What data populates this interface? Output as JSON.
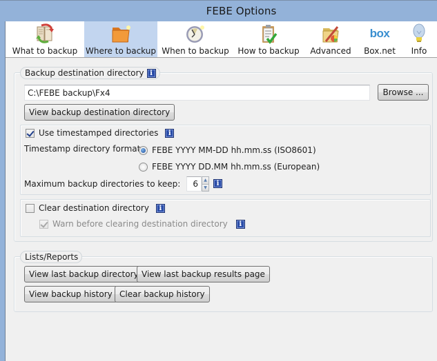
{
  "window": {
    "title": "FEBE Options"
  },
  "toolbar": {
    "items": [
      {
        "label": "What to backup",
        "icon": "backup-book-icon",
        "active": false
      },
      {
        "label": "Where to backup",
        "icon": "folder-icon",
        "active": true
      },
      {
        "label": "When to backup",
        "icon": "clock-icon",
        "active": false
      },
      {
        "label": "How to backup",
        "icon": "clipboard-check-icon",
        "active": false
      },
      {
        "label": "Advanced",
        "icon": "advanced-tools-icon",
        "active": false
      },
      {
        "label": "Box.net",
        "icon": "box-logo-icon",
        "active": false
      },
      {
        "label": "Info",
        "icon": "lightbulb-icon",
        "active": false
      }
    ],
    "box_logo_text": "box"
  },
  "destination": {
    "legend": "Backup destination directory",
    "path_value": "C:\\FEBE backup\\Fx4",
    "browse_label": "Browse ...",
    "view_dir_label": "View backup destination directory",
    "info_glyph": "i"
  },
  "timestamp": {
    "use_label": "Use timestamped directories",
    "use_checked": true,
    "format_label": "Timestamp directory format:",
    "formats": [
      {
        "label": "FEBE YYYY MM-DD hh.mm.ss (ISO8601)",
        "selected": true
      },
      {
        "label": "FEBE YYYY DD.MM hh.mm.ss (European)",
        "selected": false
      }
    ],
    "max_label": "Maximum backup directories to keep:",
    "max_value": "6",
    "spin_up": "▲",
    "spin_down": "▼"
  },
  "clear": {
    "clear_label": "Clear destination directory",
    "clear_checked": false,
    "warn_label": "Warn before clearing destination directory",
    "warn_checked": true,
    "warn_disabled": true
  },
  "reports": {
    "legend": "Lists/Reports",
    "buttons": [
      {
        "label": "View last backup directory"
      },
      {
        "label": "View last backup results page"
      },
      {
        "label": "View backup history"
      },
      {
        "label": "Clear backup history"
      }
    ]
  }
}
